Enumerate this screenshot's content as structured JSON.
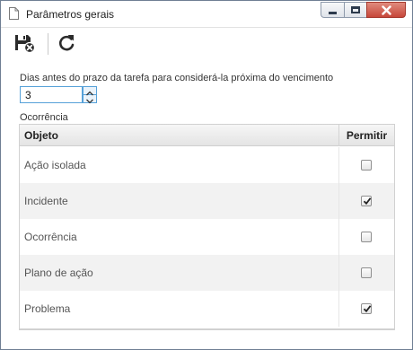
{
  "window": {
    "title": "Parâmetros gerais",
    "controls": {
      "minimize": "minimize",
      "maximize": "maximize",
      "close": "close"
    }
  },
  "toolbar": {
    "buttons": [
      {
        "name": "save-and-close",
        "icon": "save-close-icon"
      },
      {
        "name": "refresh",
        "icon": "refresh-icon"
      }
    ]
  },
  "form": {
    "days_label": "Dias antes do prazo da tarefa para considerá-la próxima do vencimento",
    "days_value": "3"
  },
  "occurrence": {
    "section_label": "Ocorrência",
    "columns": {
      "object": "Objeto",
      "allow": "Permitir"
    },
    "rows": [
      {
        "object": "Ação isolada",
        "allowed": false
      },
      {
        "object": "Incidente",
        "allowed": true
      },
      {
        "object": "Ocorrência",
        "allowed": false
      },
      {
        "object": "Plano de ação",
        "allowed": false
      },
      {
        "object": "Problema",
        "allowed": true
      }
    ]
  },
  "colors": {
    "focus_border": "#56a1d8",
    "close_button": "#c7473a",
    "row_alt": "#f2f2f2"
  }
}
